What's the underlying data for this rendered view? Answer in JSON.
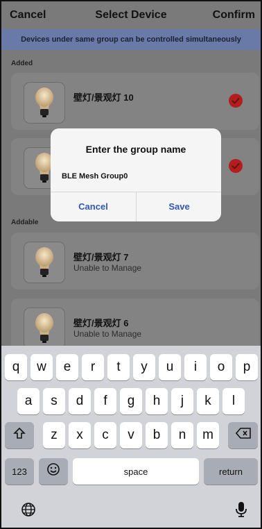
{
  "header": {
    "cancel": "Cancel",
    "title": "Select Device",
    "confirm": "Confirm"
  },
  "banner": "Devices under same group can be controlled simultaneously",
  "sections": {
    "added": "Added",
    "addable": "Addable"
  },
  "devices": [
    {
      "name": "壁灯/景观灯 10",
      "status": "",
      "checked": true
    },
    {
      "name": "",
      "status": "",
      "checked": true
    },
    {
      "name": "壁灯/景观灯 7",
      "status": "Unable to Manage",
      "checked": false
    },
    {
      "name": "壁灯/景观灯 6",
      "status": "Unable to Manage",
      "checked": false
    }
  ],
  "dialog": {
    "title": "Enter the group name",
    "input_value": "BLE Mesh Group0",
    "cancel": "Cancel",
    "save": "Save"
  },
  "keyboard": {
    "row1": [
      "q",
      "w",
      "e",
      "r",
      "t",
      "y",
      "u",
      "i",
      "o",
      "p"
    ],
    "row2": [
      "a",
      "s",
      "d",
      "f",
      "g",
      "h",
      "j",
      "k",
      "l"
    ],
    "row3": [
      "z",
      "x",
      "c",
      "v",
      "b",
      "n",
      "m"
    ],
    "numbers": "123",
    "space": "space",
    "return": "return"
  },
  "colors": {
    "accent": "#2f56b8",
    "banner": "#6979a8",
    "check": "#b21d1d"
  }
}
